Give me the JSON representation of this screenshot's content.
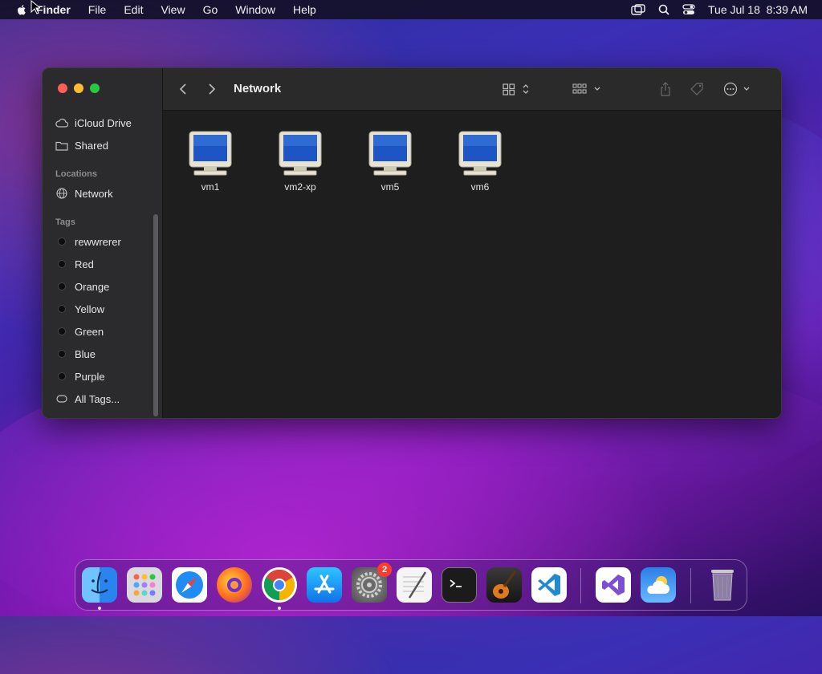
{
  "menubar": {
    "app_name": "Finder",
    "menus": [
      "File",
      "Edit",
      "View",
      "Go",
      "Window",
      "Help"
    ],
    "clock": "Tue Jul 18  8:39 AM"
  },
  "window": {
    "title": "Network",
    "sidebar": {
      "favorites": [
        {
          "label": "iCloud Drive",
          "icon": "cloud-icon"
        },
        {
          "label": "Shared",
          "icon": "shared-folder-icon"
        }
      ],
      "locations_header": "Locations",
      "locations": [
        {
          "label": "Network",
          "icon": "globe-icon"
        }
      ],
      "tags_header": "Tags",
      "tags": [
        "rewwrerer",
        "Red",
        "Orange",
        "Yellow",
        "Green",
        "Blue",
        "Purple"
      ],
      "all_tags": "All Tags..."
    },
    "files": [
      "vm1",
      "vm2-xp",
      "vm5",
      "vm6"
    ]
  },
  "dock": {
    "apps": [
      "Finder",
      "Launchpad",
      "Safari",
      "Firefox",
      "Chrome",
      "App Store",
      "System Settings",
      "TextEdit",
      "Terminal",
      "GarageBand",
      "Visual Studio Code",
      "Visual Studio",
      "Weather",
      "Trash"
    ],
    "settings_badge": "2"
  },
  "colors": {
    "window_bg": "#1e1e1e",
    "sidebar_bg": "#2b2b2d",
    "close": "#ff5f57",
    "minimize": "#febc2e",
    "zoom": "#28c840"
  }
}
